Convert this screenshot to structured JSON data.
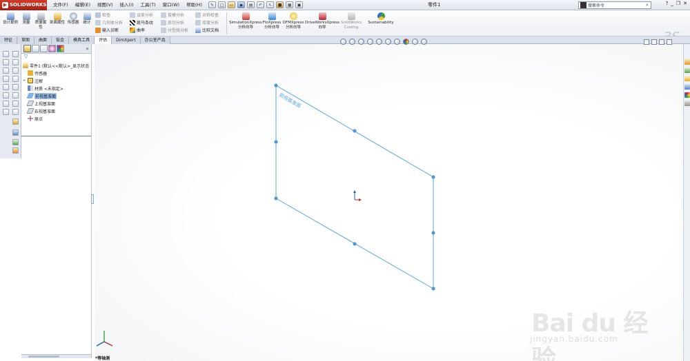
{
  "titlebar": {
    "logo": "SOLIDWORKS",
    "menus": [
      "文件(F)",
      "编辑(E)",
      "视图(V)",
      "插入(I)",
      "工具(T)",
      "窗口(W)",
      "帮助(H)"
    ],
    "document_title": "零件1",
    "search_placeholder": "搜索命令"
  },
  "commands": {
    "large": [
      {
        "label": "设计算例"
      },
      {
        "label": "测量"
      },
      {
        "label": "质量属性"
      },
      {
        "label": "剖面属性"
      },
      {
        "label": "传感器"
      },
      {
        "label": "统计"
      }
    ],
    "col1": [
      "检查",
      "几何体分析",
      "输入诊断"
    ],
    "col2": [
      "误差分析",
      "斑马条纹",
      "曲率"
    ],
    "col3": [
      "拔模分析",
      "底切分析",
      "分型线分析"
    ],
    "col4": [
      "对称检查",
      "厚度分析",
      "比较文档"
    ],
    "xpress": [
      {
        "label": "SimulationXpress 分析向导"
      },
      {
        "label": "FloXpress 分析向导"
      },
      {
        "label": "DFMXpress 分析向导"
      },
      {
        "label": "DriveWorksXpress 向导"
      },
      {
        "label": "SolidWorks Costing"
      },
      {
        "label": "Sustainability"
      }
    ]
  },
  "tabs": [
    "特征",
    "草图",
    "曲面",
    "钣金",
    "模具工具",
    "评估",
    "DimXpert",
    "办公室产品"
  ],
  "tree": {
    "root": "零件1  (默认<<默认>_显示状态",
    "items": [
      {
        "label": "传感器"
      },
      {
        "label": "注解"
      },
      {
        "label": "材质 <未指定>"
      },
      {
        "label": "前视基准面"
      },
      {
        "label": "上视基准面"
      },
      {
        "label": "右视基准面"
      },
      {
        "label": "原点"
      }
    ]
  },
  "viewport": {
    "plane_label": "前视基准面",
    "view_name": "*等轴测"
  },
  "watermark": {
    "brand": "Bai du 经验",
    "url": "jingyan.baidu.com"
  },
  "colors": {
    "plane": "#5aa7ea",
    "accent": "#1f5fb4",
    "logo_red": "#c92a1d"
  }
}
